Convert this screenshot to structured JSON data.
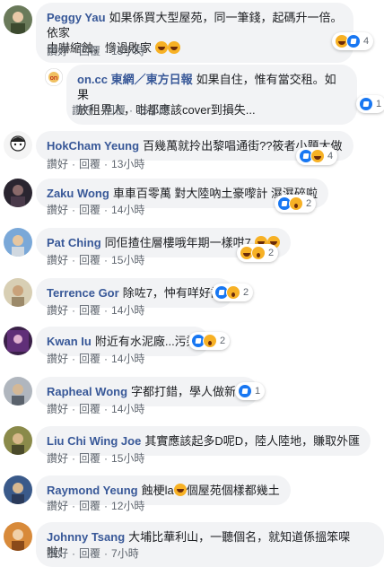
{
  "actions": {
    "like": "讚好",
    "reply": "回覆",
    "sep": "·"
  },
  "comments": [
    {
      "name": "Peggy Yau",
      "text_a": "如果係買大型屋苑，同一筆錢，起碼升一倍。依家",
      "text_b": "由嚇縮蝕，慘過敗家",
      "time": "15小時",
      "reactions": [
        "haha",
        "like"
      ],
      "count": "4",
      "avatar": "woman-avatar"
    },
    {
      "name": "on.cc 東網／東方日報",
      "text_a": "如果自住，惟有當交租。如果",
      "text_b": "放租畀人，咁都應該cover到損失...",
      "time": "15小時",
      "reactions": [
        "like"
      ],
      "count": "1",
      "avatar": "oncc-logo"
    },
    {
      "name": "HokCham Yeung",
      "text": "百幾萬就拎出黎唱通街??筱者小題大做",
      "time": "13小時",
      "reactions": [
        "like",
        "haha"
      ],
      "count": "4",
      "avatar": "cartoon-avatar"
    },
    {
      "name": "Zaku Wong",
      "text": "車車百零萬 對大陸吶土豪嚟計 濕濕碎啦",
      "time": "14小時",
      "reactions": [
        "like",
        "wow"
      ],
      "count": "2",
      "avatar": "dark-avatar"
    },
    {
      "name": "Pat Ching",
      "text": "同佢揸住層樓哦年期一樣咁7",
      "time": "15小時",
      "reactions": [
        "haha",
        "wow"
      ],
      "count": "2",
      "avatar": "sky-avatar"
    },
    {
      "name": "Terrence Gor",
      "text": "除咗7，忡有咩好講",
      "time": "14小時",
      "reactions": [
        "like",
        "wow"
      ],
      "count": "2",
      "avatar": "beige-avatar"
    },
    {
      "name": "Kwan Iu",
      "text": "附近有水泥廠...污染",
      "time": "14小時",
      "reactions": [
        "like",
        "wow"
      ],
      "count": "2",
      "avatar": "purple-avatar"
    },
    {
      "name": "Rapheal Wong",
      "text": "字都打錯，學人做新聞",
      "time": "14小時",
      "reactions": [
        "like"
      ],
      "count": "1",
      "avatar": "gray-avatar"
    },
    {
      "name": "Liu Chi Wing Joe",
      "text": "其實應該起多D呢D，陸人陸地，賺取外匯",
      "time": "15小時",
      "reactions": [],
      "count": "",
      "avatar": "olive-avatar"
    },
    {
      "name": "Raymond Yeung",
      "text_a": "蝕梗la",
      "text_b": "個屋苑個樣都幾土",
      "time": "12小時",
      "reactions": [],
      "count": "",
      "avatar": "blue-avatar"
    },
    {
      "name": "Johnny Tsang",
      "text": "大埔比華利山，一聽個名，就知道係搵笨㗎啦！",
      "time": "7小時",
      "reactions": [],
      "count": "",
      "avatar": "orange-avatar"
    }
  ]
}
